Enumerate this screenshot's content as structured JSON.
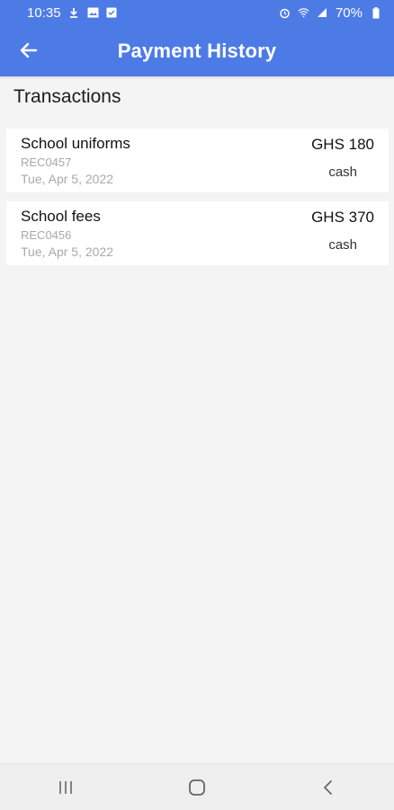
{
  "status_bar": {
    "time": "10:35",
    "battery": "70%",
    "left_icons": [
      "download-icon",
      "image-icon",
      "notification-icon"
    ],
    "right_icons": [
      "alarm-icon",
      "wifi-icon",
      "signal-icon",
      "battery-icon"
    ]
  },
  "header": {
    "title": "Payment History",
    "back_icon": "back-arrow-icon",
    "color": "#4d7be6"
  },
  "section": {
    "title": "Transactions"
  },
  "transactions": [
    {
      "title": "School uniforms",
      "ref": "REC0457",
      "date": "Tue, Apr 5, 2022",
      "amount": "GHS 180",
      "method": "cash"
    },
    {
      "title": "School fees",
      "ref": "REC0456",
      "date": "Tue, Apr 5, 2022",
      "amount": "GHS 370",
      "method": "cash"
    }
  ],
  "nav_bar": {
    "buttons": [
      "recent-apps-icon",
      "home-icon",
      "back-icon"
    ]
  }
}
